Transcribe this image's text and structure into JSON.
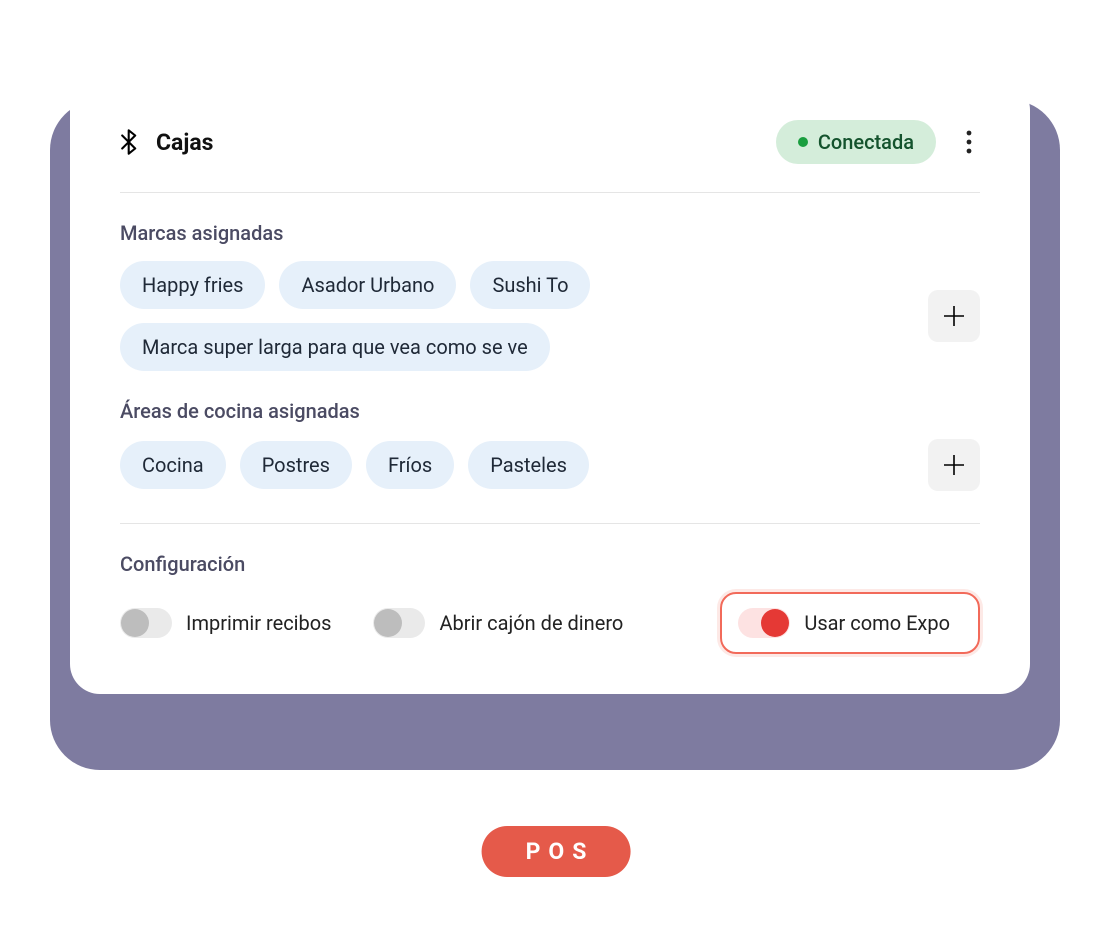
{
  "header": {
    "title": "Cajas",
    "status": "Conectada"
  },
  "brands": {
    "title": "Marcas asignadas",
    "items": [
      "Happy fries",
      "Asador Urbano",
      "Sushi To",
      "Marca super larga para que vea como se ve"
    ]
  },
  "areas": {
    "title": "Áreas de cocina asignadas",
    "items": [
      "Cocina",
      "Postres",
      "Fríos",
      "Pasteles"
    ]
  },
  "config": {
    "title": "Configuración",
    "print": "Imprimir recibos",
    "drawer": "Abrir cajón de dinero",
    "expo": "Usar como Expo"
  },
  "badge": "POS"
}
